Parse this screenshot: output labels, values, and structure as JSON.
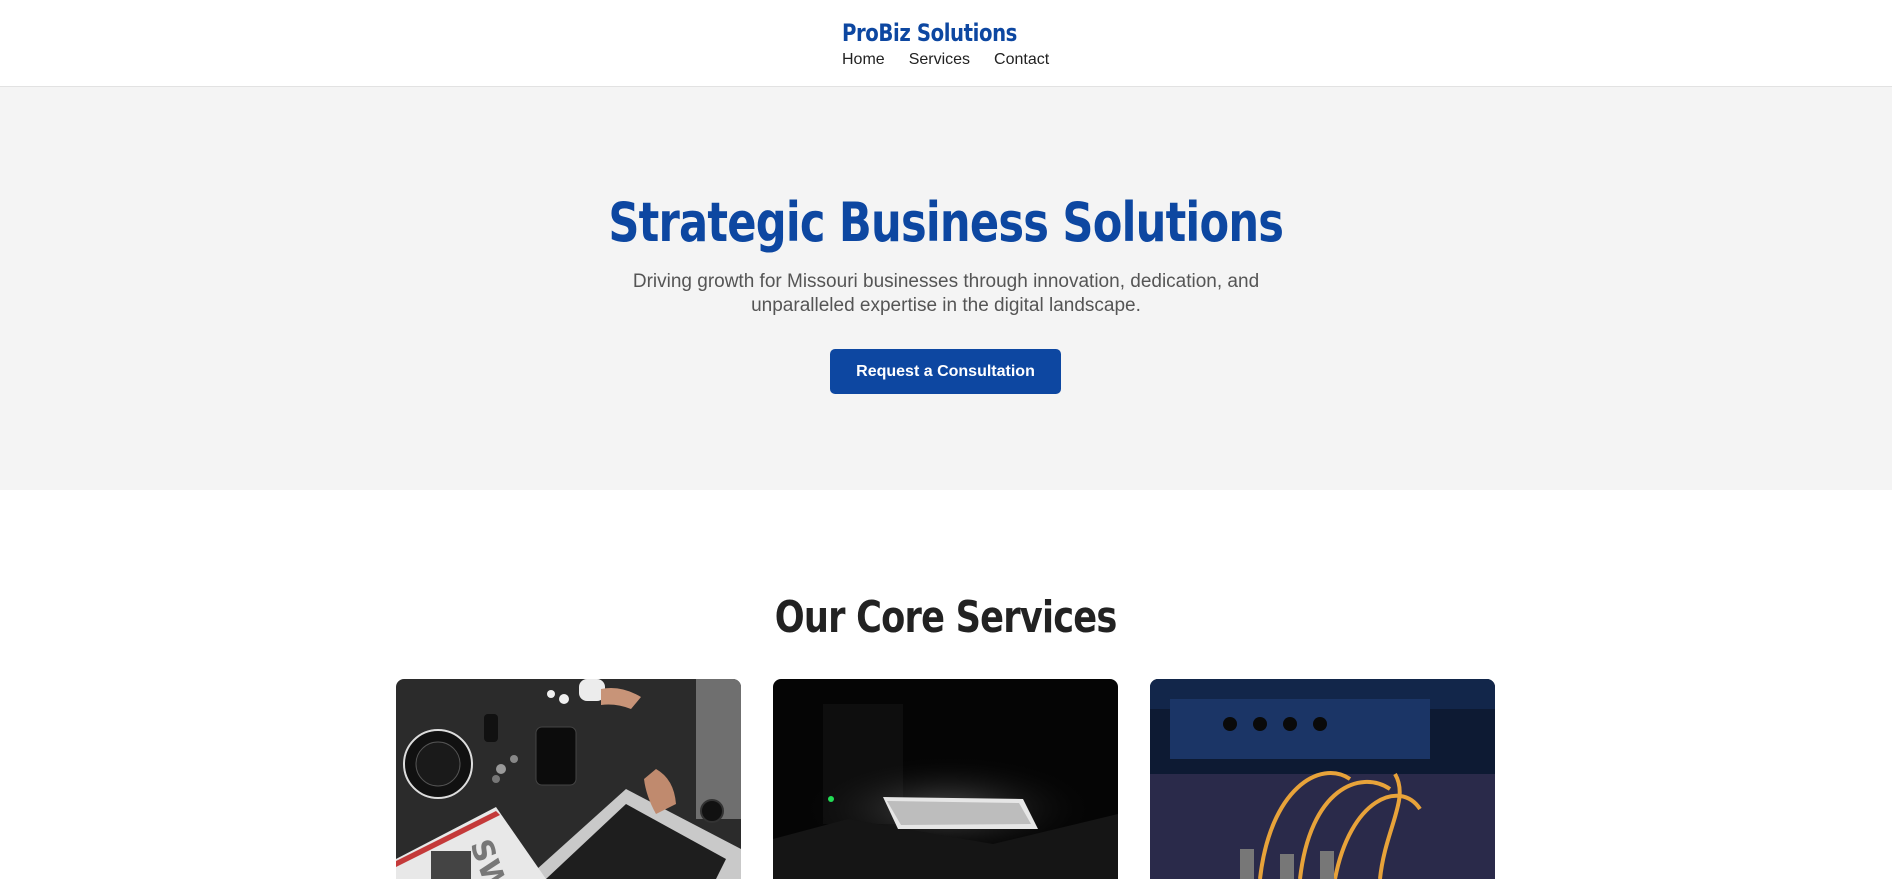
{
  "header": {
    "brand": "ProBiz Solutions",
    "nav": [
      {
        "label": "Home"
      },
      {
        "label": "Services"
      },
      {
        "label": "Contact"
      }
    ]
  },
  "hero": {
    "title": "Strategic Business Solutions",
    "subtitle": "Driving growth for Missouri businesses through innovation, dedication, and unparalleled expertise in the digital landscape.",
    "cta_label": "Request a Consultation"
  },
  "services": {
    "heading": "Our Core Services",
    "images": [
      {
        "name": "workspace-laptop-photo",
        "magazine_text": "SWA"
      },
      {
        "name": "dark-laptop-photo"
      },
      {
        "name": "network-cables-photo"
      }
    ]
  },
  "colors": {
    "brand": "#0d47a1",
    "hero_bg": "#f4f4f4",
    "text": "#222222",
    "muted": "#555555"
  }
}
